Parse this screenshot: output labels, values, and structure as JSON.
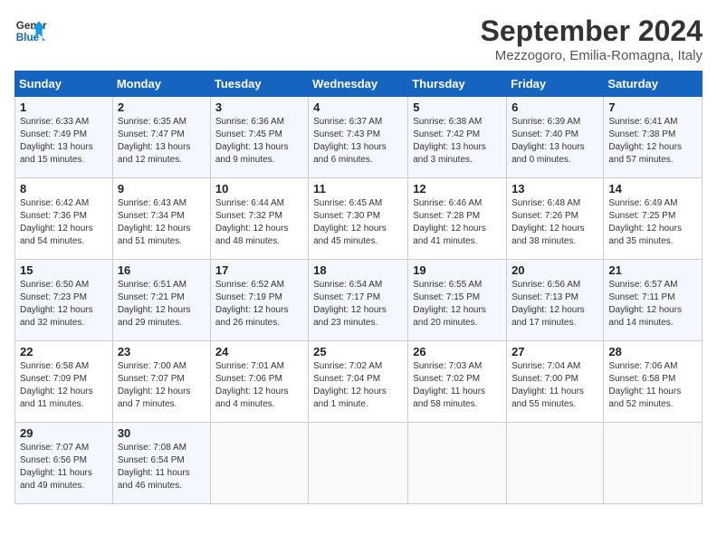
{
  "logo": {
    "line1": "General",
    "line2": "Blue"
  },
  "title": "September 2024",
  "subtitle": "Mezzogoro, Emilia-Romagna, Italy",
  "weekdays": [
    "Sunday",
    "Monday",
    "Tuesday",
    "Wednesday",
    "Thursday",
    "Friday",
    "Saturday"
  ],
  "weeks": [
    [
      {
        "day": "1",
        "sunrise": "Sunrise: 6:33 AM",
        "sunset": "Sunset: 7:49 PM",
        "daylight": "Daylight: 13 hours and 15 minutes."
      },
      {
        "day": "2",
        "sunrise": "Sunrise: 6:35 AM",
        "sunset": "Sunset: 7:47 PM",
        "daylight": "Daylight: 13 hours and 12 minutes."
      },
      {
        "day": "3",
        "sunrise": "Sunrise: 6:36 AM",
        "sunset": "Sunset: 7:45 PM",
        "daylight": "Daylight: 13 hours and 9 minutes."
      },
      {
        "day": "4",
        "sunrise": "Sunrise: 6:37 AM",
        "sunset": "Sunset: 7:43 PM",
        "daylight": "Daylight: 13 hours and 6 minutes."
      },
      {
        "day": "5",
        "sunrise": "Sunrise: 6:38 AM",
        "sunset": "Sunset: 7:42 PM",
        "daylight": "Daylight: 13 hours and 3 minutes."
      },
      {
        "day": "6",
        "sunrise": "Sunrise: 6:39 AM",
        "sunset": "Sunset: 7:40 PM",
        "daylight": "Daylight: 13 hours and 0 minutes."
      },
      {
        "day": "7",
        "sunrise": "Sunrise: 6:41 AM",
        "sunset": "Sunset: 7:38 PM",
        "daylight": "Daylight: 12 hours and 57 minutes."
      }
    ],
    [
      {
        "day": "8",
        "sunrise": "Sunrise: 6:42 AM",
        "sunset": "Sunset: 7:36 PM",
        "daylight": "Daylight: 12 hours and 54 minutes."
      },
      {
        "day": "9",
        "sunrise": "Sunrise: 6:43 AM",
        "sunset": "Sunset: 7:34 PM",
        "daylight": "Daylight: 12 hours and 51 minutes."
      },
      {
        "day": "10",
        "sunrise": "Sunrise: 6:44 AM",
        "sunset": "Sunset: 7:32 PM",
        "daylight": "Daylight: 12 hours and 48 minutes."
      },
      {
        "day": "11",
        "sunrise": "Sunrise: 6:45 AM",
        "sunset": "Sunset: 7:30 PM",
        "daylight": "Daylight: 12 hours and 45 minutes."
      },
      {
        "day": "12",
        "sunrise": "Sunrise: 6:46 AM",
        "sunset": "Sunset: 7:28 PM",
        "daylight": "Daylight: 12 hours and 41 minutes."
      },
      {
        "day": "13",
        "sunrise": "Sunrise: 6:48 AM",
        "sunset": "Sunset: 7:26 PM",
        "daylight": "Daylight: 12 hours and 38 minutes."
      },
      {
        "day": "14",
        "sunrise": "Sunrise: 6:49 AM",
        "sunset": "Sunset: 7:25 PM",
        "daylight": "Daylight: 12 hours and 35 minutes."
      }
    ],
    [
      {
        "day": "15",
        "sunrise": "Sunrise: 6:50 AM",
        "sunset": "Sunset: 7:23 PM",
        "daylight": "Daylight: 12 hours and 32 minutes."
      },
      {
        "day": "16",
        "sunrise": "Sunrise: 6:51 AM",
        "sunset": "Sunset: 7:21 PM",
        "daylight": "Daylight: 12 hours and 29 minutes."
      },
      {
        "day": "17",
        "sunrise": "Sunrise: 6:52 AM",
        "sunset": "Sunset: 7:19 PM",
        "daylight": "Daylight: 12 hours and 26 minutes."
      },
      {
        "day": "18",
        "sunrise": "Sunrise: 6:54 AM",
        "sunset": "Sunset: 7:17 PM",
        "daylight": "Daylight: 12 hours and 23 minutes."
      },
      {
        "day": "19",
        "sunrise": "Sunrise: 6:55 AM",
        "sunset": "Sunset: 7:15 PM",
        "daylight": "Daylight: 12 hours and 20 minutes."
      },
      {
        "day": "20",
        "sunrise": "Sunrise: 6:56 AM",
        "sunset": "Sunset: 7:13 PM",
        "daylight": "Daylight: 12 hours and 17 minutes."
      },
      {
        "day": "21",
        "sunrise": "Sunrise: 6:57 AM",
        "sunset": "Sunset: 7:11 PM",
        "daylight": "Daylight: 12 hours and 14 minutes."
      }
    ],
    [
      {
        "day": "22",
        "sunrise": "Sunrise: 6:58 AM",
        "sunset": "Sunset: 7:09 PM",
        "daylight": "Daylight: 12 hours and 11 minutes."
      },
      {
        "day": "23",
        "sunrise": "Sunrise: 7:00 AM",
        "sunset": "Sunset: 7:07 PM",
        "daylight": "Daylight: 12 hours and 7 minutes."
      },
      {
        "day": "24",
        "sunrise": "Sunrise: 7:01 AM",
        "sunset": "Sunset: 7:06 PM",
        "daylight": "Daylight: 12 hours and 4 minutes."
      },
      {
        "day": "25",
        "sunrise": "Sunrise: 7:02 AM",
        "sunset": "Sunset: 7:04 PM",
        "daylight": "Daylight: 12 hours and 1 minute."
      },
      {
        "day": "26",
        "sunrise": "Sunrise: 7:03 AM",
        "sunset": "Sunset: 7:02 PM",
        "daylight": "Daylight: 11 hours and 58 minutes."
      },
      {
        "day": "27",
        "sunrise": "Sunrise: 7:04 AM",
        "sunset": "Sunset: 7:00 PM",
        "daylight": "Daylight: 11 hours and 55 minutes."
      },
      {
        "day": "28",
        "sunrise": "Sunrise: 7:06 AM",
        "sunset": "Sunset: 6:58 PM",
        "daylight": "Daylight: 11 hours and 52 minutes."
      }
    ],
    [
      {
        "day": "29",
        "sunrise": "Sunrise: 7:07 AM",
        "sunset": "Sunset: 6:56 PM",
        "daylight": "Daylight: 11 hours and 49 minutes."
      },
      {
        "day": "30",
        "sunrise": "Sunrise: 7:08 AM",
        "sunset": "Sunset: 6:54 PM",
        "daylight": "Daylight: 11 hours and 46 minutes."
      },
      null,
      null,
      null,
      null,
      null
    ]
  ]
}
